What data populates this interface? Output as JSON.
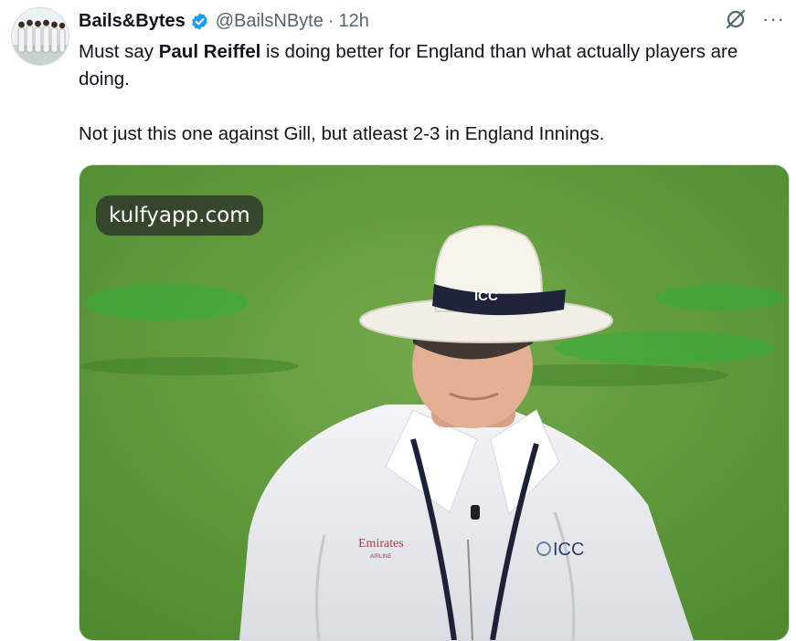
{
  "tweet": {
    "author_name": "Bails&Bytes",
    "handle": "@BailsNByte",
    "separator": "·",
    "time": "12h",
    "text": {
      "prefix": "Must say ",
      "bold": "Paul Reiffel",
      "suffix": " is doing better for England than what actually players are doing.",
      "paragraph2": "Not just this one against Gill, but atleast 2-3 in England Innings."
    },
    "more_label": "···"
  },
  "media": {
    "watermark": "kulfyapp.com",
    "hat_band_text": "ICC",
    "shirt_sponsor": "Emirates",
    "shirt_sponsor_sub": "AIRLINE",
    "shirt_logo": "ICC"
  },
  "icons": {
    "verified": "verified-badge-icon",
    "grok": "grok-icon",
    "more": "more-icon"
  },
  "colors": {
    "verified_blue": "#1d9bf0",
    "text_primary": "#0f1419",
    "text_secondary": "#536471",
    "pitch_green": "#5d9b3a"
  }
}
